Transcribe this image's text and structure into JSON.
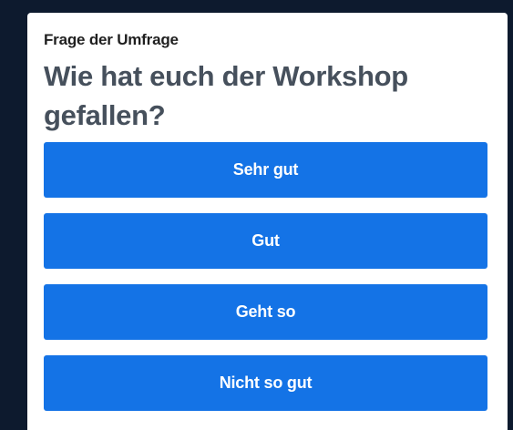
{
  "poll": {
    "kicker": "Frage der Umfrage",
    "question": "Wie hat euch der Workshop gefallen?",
    "options": [
      {
        "label": "Sehr gut"
      },
      {
        "label": "Gut"
      },
      {
        "label": "Geht so"
      },
      {
        "label": "Nicht so gut"
      }
    ]
  },
  "colors": {
    "page_background": "#0d1a2e",
    "card_background": "#ffffff",
    "button": "#1473e6",
    "button_text": "#ffffff",
    "question_text": "#46505c"
  }
}
